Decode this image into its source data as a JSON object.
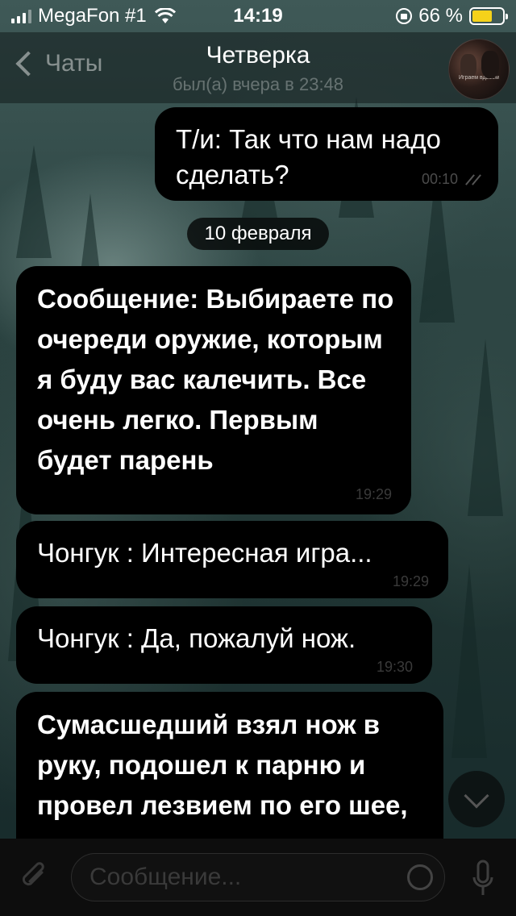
{
  "status_bar": {
    "carrier": "MegaFon #1",
    "time": "14:19",
    "battery_percent": "66 %",
    "battery_level": 0.66,
    "icons": [
      "signal-icon",
      "wifi-icon",
      "orientation-lock-icon",
      "battery-icon"
    ]
  },
  "header": {
    "back_label": "Чаты",
    "title": "Четверка",
    "subtitle": "был(а) вчера в 23:48",
    "avatar_caption": "Играем вдвоём"
  },
  "messages": [
    {
      "direction": "outgoing",
      "text": "Т/и: Так что нам надо сделать?",
      "time": "00:10",
      "read": true
    },
    {
      "direction": "incoming",
      "text": "Сообщение: Выбираете по очереди оружие, которым я буду вас калечить. Все очень легко. Первым будет парень",
      "time": "19:29"
    },
    {
      "direction": "incoming",
      "text": "Чонгук : Интересная игра...",
      "time": "19:29"
    },
    {
      "direction": "incoming",
      "text": "Чонгук : Да, пожалуй нож.",
      "time": "19:30"
    },
    {
      "direction": "incoming",
      "text": "Сумасшедший взял нож в руку, подошел к парню и провел лезвием по его шее, после чего вниз",
      "time": ""
    }
  ],
  "date_separator": "10 февраля",
  "composer": {
    "placeholder": "Сообщение..."
  },
  "colors": {
    "bubble": "#000000",
    "timestamp": "#3a3a3a",
    "battery": "#f5d21a"
  }
}
